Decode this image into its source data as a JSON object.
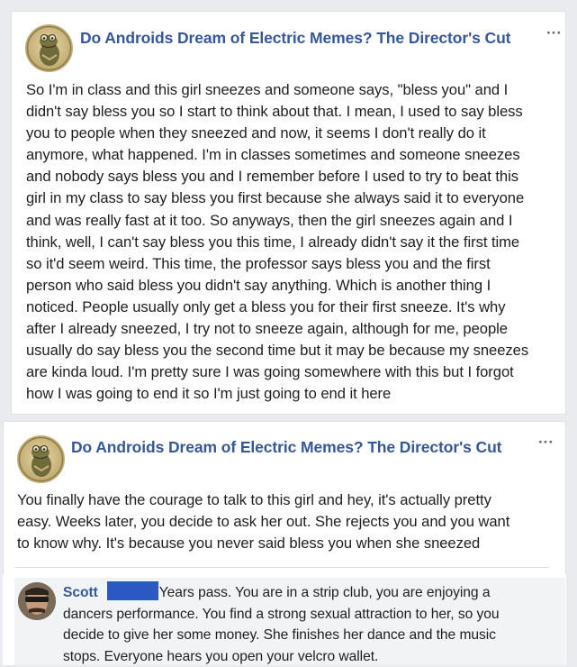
{
  "post1": {
    "page_name": "Do Androids Dream of Electric Memes? The Director's Cut",
    "more_label": "···",
    "lines": [
      "So I'm in class and this girl sneezes and someone says, \"bless you\" and I",
      "didn't say bless you so I start to think about that. I mean, I used to say bless",
      "you to people when they sneezed and now, it seems I don't really do it",
      "anymore, what happened. I'm in classes sometimes and someone sneezes",
      "and nobody says bless you and I remember before I used to try to beat this",
      "girl in my class to say bless you first because she always said it to everyone",
      "and was really fast at it too. So anyways, then the girl sneezes again and I",
      "think, well, I can't say bless you this time, I already didn't say it the first time",
      "so it'd seem weird. This time, the professor says bless you and the first",
      "person who said bless you didn't say anything. Which is another thing I",
      "noticed. People usually only get a bless you for their first sneeze. It's why",
      "after I already sneezed, I try not to sneeze again, although for me, people",
      "usually do say bless you the second time but it may be because my sneezes",
      "are kinda loud. I'm pretty sure I was going somewhere with this but I forgot",
      "how I was going to end it so I'm just going to end it here"
    ]
  },
  "post2": {
    "page_name": "Do Androids Dream of Electric Memes? The Director's Cut",
    "more_label": "···",
    "lines": [
      "You finally have the courage to talk to this girl and hey, it's actually pretty",
      "easy. Weeks later, you decide to ask her out. She rejects you and you want",
      "to know why. It's because you never said bless you when she sneezed"
    ]
  },
  "comment": {
    "author": "Scott",
    "first_line": "Years pass. You are in a strip club, you are enjoying a",
    "lines": [
      "dancers performance. You find a strong sexual attraction to her, so you",
      "decide to give her some money. She finishes her dance and the music",
      "stops. Everyone hears you open your velcro wallet."
    ]
  },
  "colors": {
    "link": "#365899",
    "text": "#1c1e21",
    "background": "#e9ebee",
    "comment_bubble": "#f2f3f5",
    "redaction": "#2b59c3"
  },
  "icons": {
    "page_avatar": "kermit-frog-coin-icon",
    "more": "more-options-icon",
    "comment_avatar": "user-avatar"
  }
}
